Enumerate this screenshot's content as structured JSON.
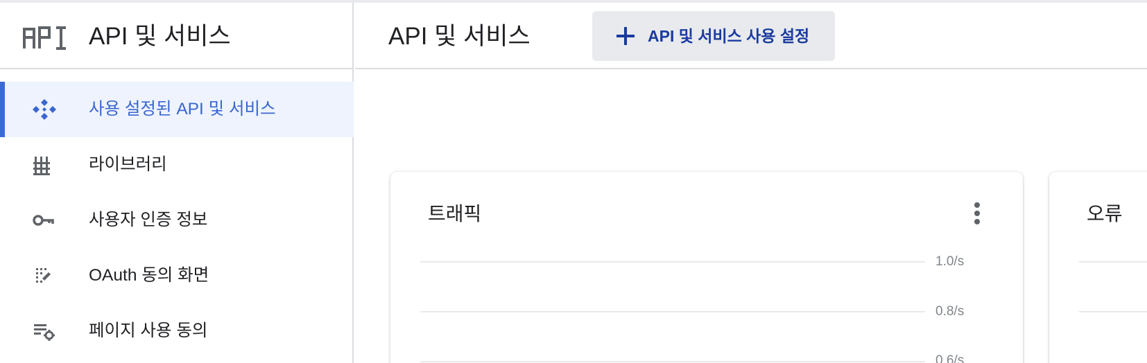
{
  "sidebar": {
    "logo_icon": "api-logo-icon",
    "title": "API 및 서비스",
    "items": [
      {
        "label": "사용 설정된 API 및 서비스",
        "icon": "api-diamond-icon",
        "active": true
      },
      {
        "label": "라이브러리",
        "icon": "library-icon",
        "active": false
      },
      {
        "label": "사용자 인증 정보",
        "icon": "key-icon",
        "active": false
      },
      {
        "label": "OAuth 동의 화면",
        "icon": "oauth-consent-icon",
        "active": false
      },
      {
        "label": "페이지 사용 동의",
        "icon": "page-settings-icon",
        "active": false
      }
    ]
  },
  "header": {
    "title": "API 및 서비스",
    "enable_button": {
      "label": "API 및 서비스 사용 설정",
      "icon": "plus-icon"
    }
  },
  "cards": {
    "traffic": {
      "title": "트래픽",
      "menu_icon": "more-vert-icon",
      "y_ticks": [
        "1.0/s",
        "0.8/s",
        "0.6/s"
      ]
    },
    "errors": {
      "title": "오류"
    }
  },
  "colors": {
    "accent": "#3a66cf",
    "active_bg": "#eef3fd",
    "button_bg": "#e8eaed",
    "button_text": "#1a3a9e",
    "divider": "#dadce0"
  }
}
